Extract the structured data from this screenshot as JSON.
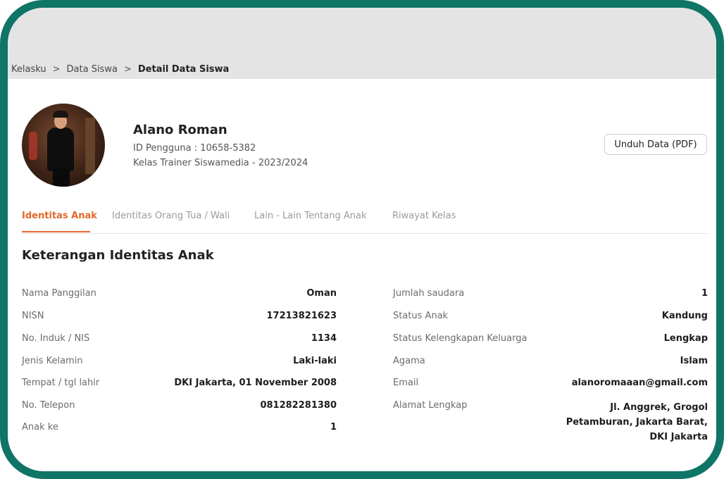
{
  "breadcrumb": {
    "items": [
      "Kelasku",
      "Data Siswa"
    ],
    "separator": ">",
    "current": "Detail Data Siswa"
  },
  "profile": {
    "name": "Alano Roman",
    "user_id": "ID Pengguna : 10658-5382",
    "class_info": "Kelas Trainer Siswamedia - 2023/2024",
    "download_label": "Unduh Data (PDF)"
  },
  "tabs": [
    {
      "label": "Identitas Anak",
      "active": true
    },
    {
      "label": "Identitas Orang Tua / Wali",
      "active": false
    },
    {
      "label": "Lain - Lain Tentang Anak",
      "active": false
    },
    {
      "label": "Riwayat Kelas",
      "active": false
    }
  ],
  "section": {
    "title": "Keterangan Identitas Anak",
    "left_fields": [
      {
        "label": "Nama Panggilan",
        "value": "Oman"
      },
      {
        "label": "NISN",
        "value": "17213821623"
      },
      {
        "label": "No. Induk / NIS",
        "value": "1134"
      },
      {
        "label": "Jenis Kelamin",
        "value": "Laki-laki"
      },
      {
        "label": "Tempat / tgl lahir",
        "value": "DKI Jakarta, 01 November 2008"
      },
      {
        "label": "No. Telepon",
        "value": "081282281380"
      },
      {
        "label": "Anak ke",
        "value": "1"
      }
    ],
    "right_fields": [
      {
        "label": "Jumlah saudara",
        "value": "1"
      },
      {
        "label": "Status Anak",
        "value": "Kandung"
      },
      {
        "label": "Status Kelengkapan Keluarga",
        "value": "Lengkap"
      },
      {
        "label": "Agama",
        "value": "Islam"
      },
      {
        "label": "Email",
        "value": "alanoromaaan@gmail.com"
      },
      {
        "label": "Alamat Lengkap",
        "value": "Jl. Anggrek, Grogol Petamburan, Jakarta Barat, DKI Jakarta"
      }
    ]
  },
  "colors": {
    "frame": "#0f7566",
    "accent": "#e0692a",
    "topbar": "#e4e4e4"
  }
}
